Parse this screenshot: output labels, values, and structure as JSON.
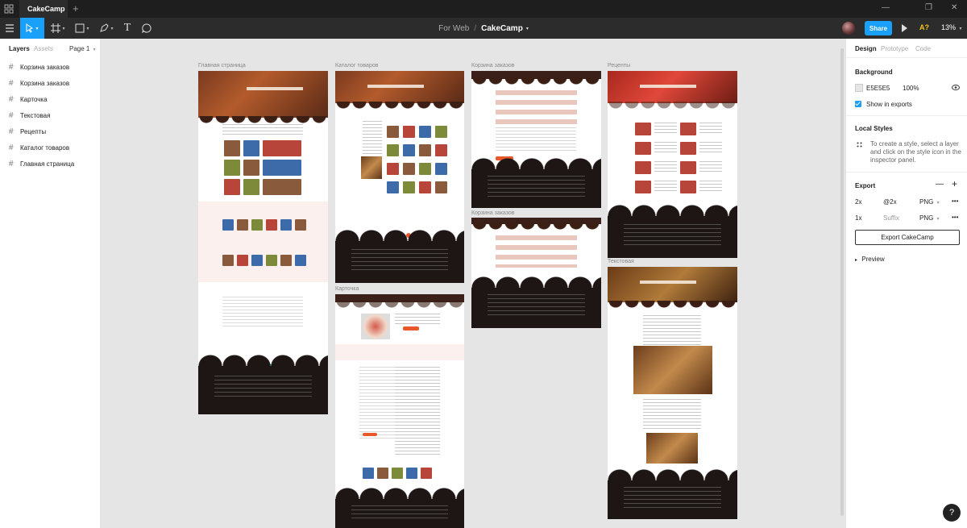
{
  "titlebar": {
    "tab_label": "CakeCamp",
    "new_tab": "+",
    "controls": {
      "minimize": "—",
      "restore": "❐",
      "close": "✕"
    }
  },
  "toolbar": {
    "project": "For Web",
    "separator": "/",
    "file": "CakeCamp",
    "file_caret": "▾",
    "share_label": "Share",
    "a11y_label": "A?",
    "zoom_label": "13%",
    "zoom_caret": "▾",
    "caret": "▾",
    "text_tool": "T"
  },
  "left_panel": {
    "tabs": [
      "Layers",
      "Assets"
    ],
    "page_label": "Page 1",
    "page_caret": "▾",
    "hash": "#",
    "layers": [
      "Корзина заказов",
      "Корзина заказов",
      "Карточка",
      "Текстовая",
      "Рецепты",
      "Каталог товаров",
      "Главная страница"
    ]
  },
  "canvas": {
    "frame_labels": {
      "home": "Главная страница",
      "catalog": "Каталог товаров",
      "cart1": "Корзина заказов",
      "recipes": "Рецепты",
      "cart2": "Корзина заказов",
      "card": "Карточка",
      "text": "Текстовая"
    }
  },
  "right_panel": {
    "tabs": [
      "Design",
      "Prototype",
      "Code"
    ],
    "background": {
      "heading": "Background",
      "color": "E5E5E5",
      "opacity": "100%",
      "show_in_exports": "Show in exports"
    },
    "local_styles": {
      "heading": "Local Styles",
      "hint": "To create a style, select a layer and click on the style icon in the inspector panel."
    },
    "export": {
      "heading": "Export",
      "minus": "—",
      "plus": "+",
      "more": "•••",
      "rows": [
        {
          "scale": "2x",
          "suffix": "@2x",
          "format": "PNG"
        },
        {
          "scale": "1x",
          "suffix": "Suffix",
          "format": "PNG"
        }
      ],
      "format_caret": "▾",
      "button": "Export CakeCamp",
      "preview": "Preview",
      "preview_caret": "▸"
    }
  },
  "help_label": "?",
  "colors": {
    "accent": "#18a0fb",
    "canvas_bg": "#e5e5e5",
    "toolbar_bg": "#2c2c2c",
    "titlebar_bg": "#1e1e1e"
  }
}
